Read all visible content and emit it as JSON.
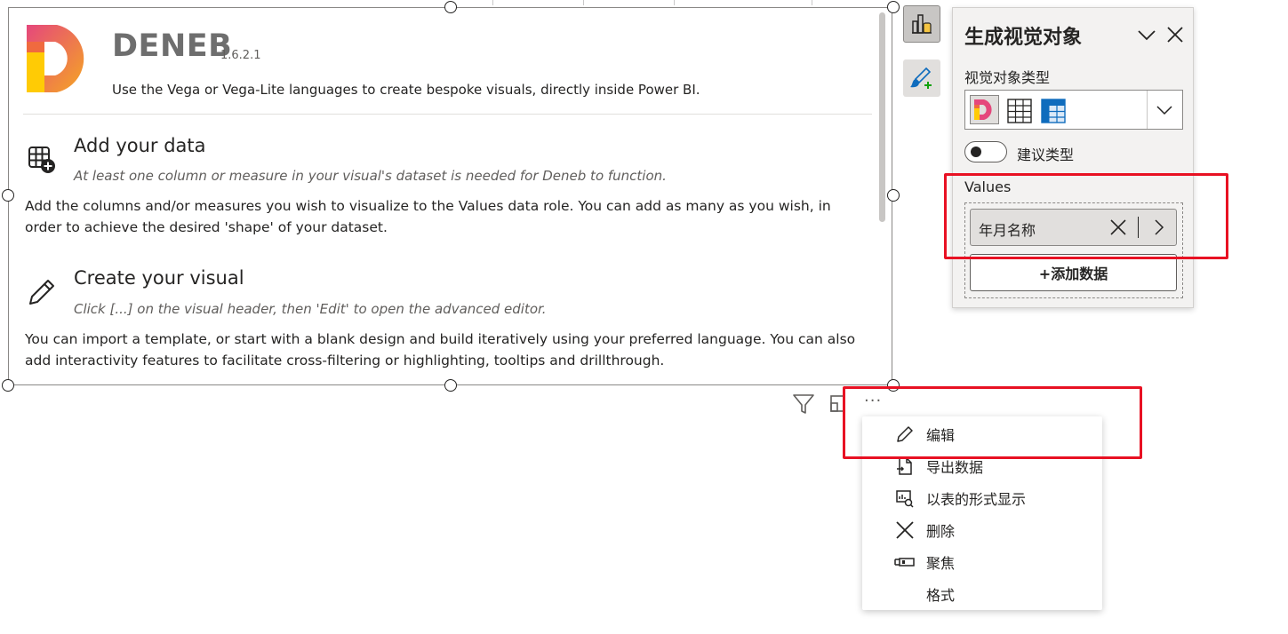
{
  "app": {
    "logo_text": "DENEB",
    "version": "1.6.2.1",
    "subtitle": "Use the Vega or Vega-Lite languages to create bespoke visuals, directly inside Power BI."
  },
  "sections": [
    {
      "heading": "Add your data",
      "hint": "At least one column or measure in your visual's dataset is needed for Deneb to function.",
      "body": "Add the columns and/or measures you wish to visualize to the Values data role. You can add as many as you wish, in order to achieve the desired 'shape' of your dataset.",
      "icon": "table-add-icon"
    },
    {
      "heading": "Create your visual",
      "hint": "Click [...] on the visual header, then 'Edit' to open the advanced editor.",
      "body": "You can import a template, or start with a blank design and build iteratively using your preferred language. You can also add interactivity features to facilitate cross-filtering or highlighting, tooltips and drillthrough.",
      "icon": "pencil-icon"
    }
  ],
  "visual_header": {
    "icons": [
      "filter-icon",
      "focus-mode-icon",
      "more-options-icon"
    ],
    "more_label": "···"
  },
  "context_menu": {
    "items": [
      {
        "label": "编辑",
        "icon": "pencil-icon"
      },
      {
        "label": "导出数据",
        "icon": "export-data-icon"
      },
      {
        "label": "以表的形式显示",
        "icon": "show-as-table-icon"
      },
      {
        "label": "删除",
        "icon": "close-icon"
      },
      {
        "label": "聚焦",
        "icon": "spotlight-icon"
      },
      {
        "label": "格式",
        "icon": ""
      }
    ]
  },
  "build_pane": {
    "title": "生成视觉对象",
    "visual_type_label": "视觉对象类型",
    "visual_types": [
      "deneb-visual-icon",
      "table-icon",
      "matrix-icon"
    ],
    "suggest_type_label": "建议类型",
    "values_label": "Values",
    "field_value": "年月名称",
    "add_data_label": "+添加数据"
  },
  "colors": {
    "deneb_orange": "#f5a623",
    "deneb_pink": "#e5477c",
    "annotation_red": "#e81123"
  }
}
